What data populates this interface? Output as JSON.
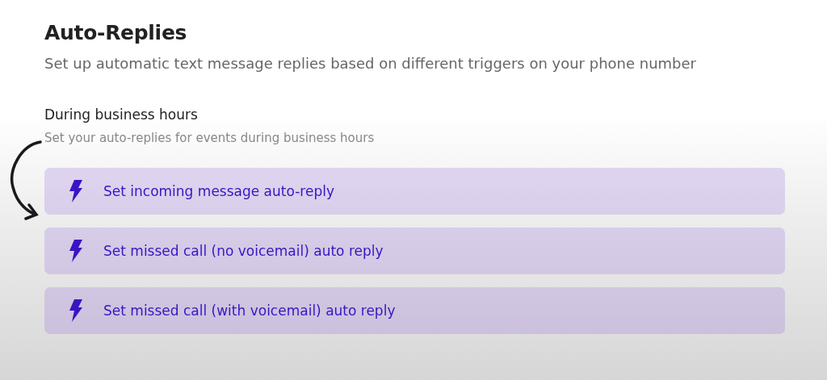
{
  "title": "Auto-Replies",
  "description": "Set up automatic text message replies based on different triggers on your phone number",
  "section": {
    "title": "During business hours",
    "subtitle": "Set your auto-replies for events during business hours"
  },
  "actions": [
    {
      "label": "Set incoming message auto-reply"
    },
    {
      "label": "Set missed call (no voicemail) auto reply"
    },
    {
      "label": "Set missed call (with voicemail) auto reply"
    }
  ]
}
